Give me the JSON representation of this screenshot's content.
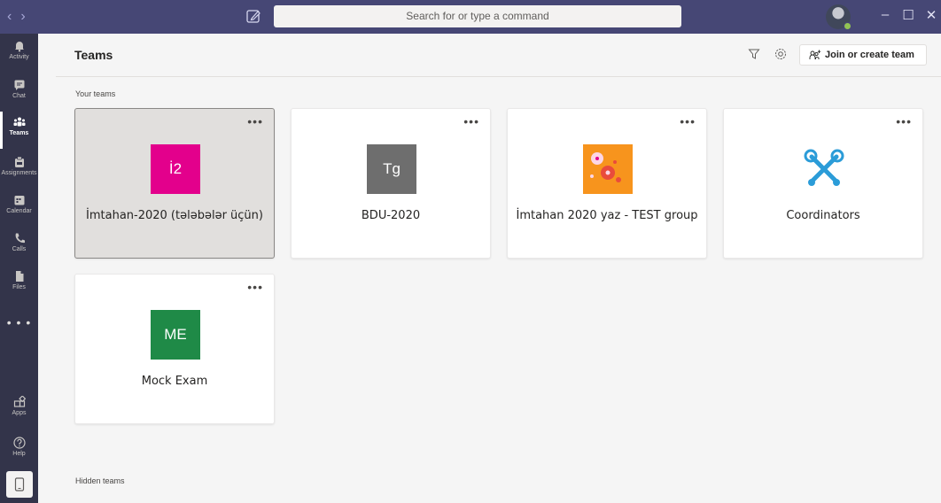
{
  "titlebar": {
    "back_label": "‹",
    "forward_label": "›",
    "search_placeholder": "Search for or type a command",
    "minimize_label": "–",
    "maximize_label": "☐",
    "close_label": "✕"
  },
  "rail": {
    "items": [
      {
        "label": "Activity",
        "icon": "bell-icon"
      },
      {
        "label": "Chat",
        "icon": "chat-icon"
      },
      {
        "label": "Teams",
        "icon": "teams-icon"
      },
      {
        "label": "Assignments",
        "icon": "assignments-icon"
      },
      {
        "label": "Calendar",
        "icon": "calendar-icon"
      },
      {
        "label": "Calls",
        "icon": "phone-icon"
      },
      {
        "label": "Files",
        "icon": "file-icon"
      }
    ],
    "more_label": "• • •",
    "apps_label": "Apps",
    "help_label": "Help",
    "active": "Teams"
  },
  "header": {
    "title": "Teams",
    "join_label": "Join or create team"
  },
  "sections": {
    "your_teams": "Your teams",
    "hidden_teams": "Hidden teams"
  },
  "teams": [
    {
      "initials": "İ2",
      "name": "İmtahan-2020 (tələbələr üçün)",
      "color": "#e3008c",
      "selected": true
    },
    {
      "initials": "Tg",
      "name": "BDU-2020",
      "color": "#6e6e6e",
      "selected": false
    },
    {
      "initials": "",
      "name": "İmtahan 2020 yaz - TEST group",
      "color": "#f7941d",
      "selected": false,
      "icon": "flower-icon"
    },
    {
      "initials": "",
      "name": "Coordinators",
      "color": "#ffffff",
      "selected": false,
      "icon": "tools-icon"
    },
    {
      "initials": "ME",
      "name": "Mock Exam",
      "color": "#1f8a47",
      "selected": false
    }
  ],
  "colors": {
    "titlebar": "#464775",
    "rail": "#33344a",
    "background": "#f5f5f5"
  }
}
